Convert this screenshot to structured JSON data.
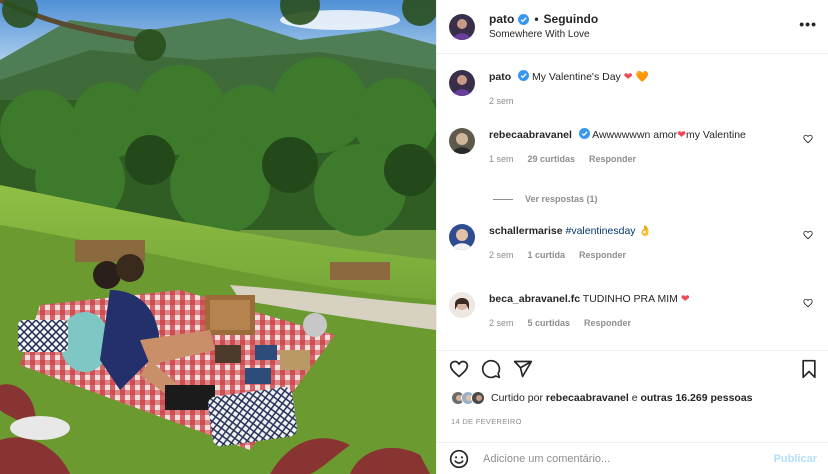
{
  "post": {
    "author": "pato",
    "follow_status": "Seguindo",
    "location": "Somewhere With Love",
    "more_label": "•••",
    "dot": "•"
  },
  "caption": {
    "user": "pato",
    "text": "My Valentine's Day",
    "hearts": [
      "❤",
      "🧡"
    ],
    "time": "2 sem"
  },
  "comments": [
    {
      "user": "rebecaabravanel",
      "verified": true,
      "text_before": "Awwwwwwn amor",
      "heart": "❤",
      "text_after": "my Valentine",
      "time": "1 sem",
      "likes": "29 curtidas",
      "reply": "Responder"
    },
    {
      "user": "schallermarise",
      "verified": false,
      "hashtag": "#valentinesday",
      "emoji": "👌",
      "time": "2 sem",
      "likes": "1 curtida",
      "reply": "Responder"
    },
    {
      "user": "beca_abravanel.fc",
      "verified": false,
      "text": "TUDINHO PRA MIM",
      "heart": "❤",
      "time": "2 sem",
      "likes": "5 curtidas",
      "reply": "Responder"
    }
  ],
  "view_replies": "Ver respostas (1)",
  "liked_by": {
    "prefix": "Curtido por",
    "user": "rebecaabravanel",
    "middle": "e",
    "others": "outras 16.269 pessoas"
  },
  "date": "14 DE FEVEREIRO",
  "add_comment": {
    "placeholder": "Adicione um comentário...",
    "publish": "Publicar"
  },
  "colors": {
    "verified": "#3897f0",
    "heart": "#ed4956",
    "link": "#00376b",
    "publish_disabled": "#b2dffc",
    "secondary": "#8e8e8e"
  },
  "icons": [
    "more-options-icon",
    "verified-badge-icon",
    "like-heart-icon",
    "comment-icon",
    "share-icon",
    "bookmark-icon",
    "emoji-icon"
  ]
}
